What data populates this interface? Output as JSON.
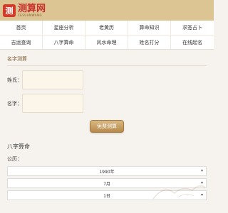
{
  "logo": {
    "mark": "测",
    "title": "测算网",
    "subtitle": "CESUANWANG"
  },
  "nav": {
    "row1": [
      "首页",
      "星座分析",
      "老黄历",
      "算命知识",
      "求签占卜"
    ],
    "row2": [
      "吉运查询",
      "八字算命",
      "风水命理",
      "姓名打分",
      "在线起名"
    ]
  },
  "name_test": {
    "title": "名字测算",
    "surname_label": "姓氏：",
    "name_label": "名字：",
    "submit_label": "免费测算"
  },
  "bazi": {
    "title": "八字算命",
    "calendar_label": "公历：",
    "year_value": "1990年",
    "month_value": "7月",
    "day_value": "1日"
  },
  "icons": {
    "select_chevron": "chevron-down-icon"
  }
}
